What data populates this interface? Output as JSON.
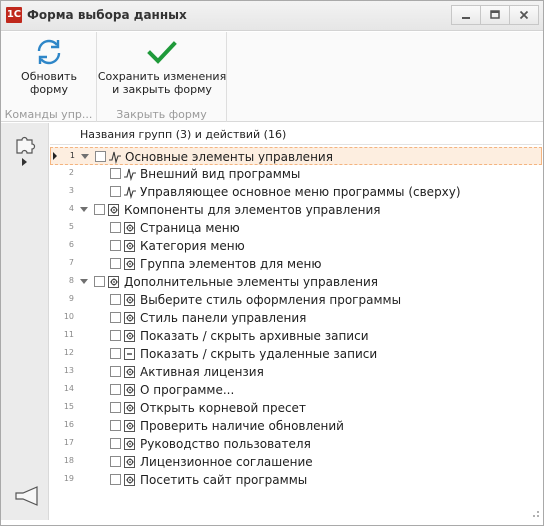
{
  "window": {
    "title": "Форма выбора данных",
    "app_icon_text": "1C"
  },
  "ribbon": {
    "groups": [
      {
        "caption": "Команды упр...",
        "buttons": [
          {
            "label_line1": "Обновить",
            "label_line2": "форму",
            "icon": "refresh-icon"
          }
        ]
      },
      {
        "caption": "Закрыть форму",
        "buttons": [
          {
            "label_line1": "Сохранить изменения",
            "label_line2": "и закрыть форму",
            "icon": "checkmark-icon"
          }
        ]
      }
    ]
  },
  "tree": {
    "header": "Названия групп (3) и действий (16)",
    "rows": [
      {
        "num": "1",
        "label": "Основные элементы управления",
        "level": 0,
        "expanded": true,
        "icon": "signal-icon",
        "selected": true
      },
      {
        "num": "2",
        "label": "Внешний вид программы",
        "level": 1,
        "icon": "signal-icon"
      },
      {
        "num": "3",
        "label": "Управляющее основное меню программы (сверху)",
        "level": 1,
        "icon": "signal-icon"
      },
      {
        "num": "4",
        "label": "Компоненты для элементов управления",
        "level": 0,
        "expanded": true,
        "icon": "gear-doc-icon"
      },
      {
        "num": "5",
        "label": "Страница меню",
        "level": 1,
        "icon": "gear-doc-icon"
      },
      {
        "num": "6",
        "label": "Категория меню",
        "level": 1,
        "icon": "gear-doc-icon"
      },
      {
        "num": "7",
        "label": "Группа элементов для меню",
        "level": 1,
        "icon": "gear-doc-icon"
      },
      {
        "num": "8",
        "label": "Дополнительные элементы управления",
        "level": 0,
        "expanded": true,
        "icon": "gear-doc-icon"
      },
      {
        "num": "9",
        "label": "Выберите стиль оформления программы",
        "level": 1,
        "icon": "gear-doc-icon"
      },
      {
        "num": "10",
        "label": "Стиль панели управления",
        "level": 1,
        "icon": "gear-doc-icon"
      },
      {
        "num": "11",
        "label": "Показать / скрыть архивные записи",
        "level": 1,
        "icon": "gear-doc-icon"
      },
      {
        "num": "12",
        "label": "Показать / скрыть удаленные записи",
        "level": 1,
        "icon": "dash-doc-icon"
      },
      {
        "num": "13",
        "label": "Активная лицензия",
        "level": 1,
        "icon": "gear-doc-icon"
      },
      {
        "num": "14",
        "label": "О программе...",
        "level": 1,
        "icon": "gear-doc-icon"
      },
      {
        "num": "15",
        "label": "Открыть корневой пресет",
        "level": 1,
        "icon": "gear-doc-icon"
      },
      {
        "num": "16",
        "label": "Проверить наличие обновлений",
        "level": 1,
        "icon": "gear-doc-icon"
      },
      {
        "num": "17",
        "label": "Руководство пользователя",
        "level": 1,
        "icon": "gear-doc-icon"
      },
      {
        "num": "18",
        "label": "Лицензионное соглашение",
        "level": 1,
        "icon": "gear-doc-icon"
      },
      {
        "num": "19",
        "label": "Посетить сайт программы",
        "level": 1,
        "icon": "gear-doc-icon"
      }
    ]
  },
  "sidepanel": {
    "icons": [
      "puzzle-icon",
      "megaphone-icon"
    ]
  },
  "colors": {
    "refresh_icon": "#2e86c8",
    "checkmark_icon": "#1f9a3a",
    "selected_row_bg": "#fdeee0",
    "selected_row_border": "#f4b47f",
    "app_icon_bg": "#c0281c"
  }
}
